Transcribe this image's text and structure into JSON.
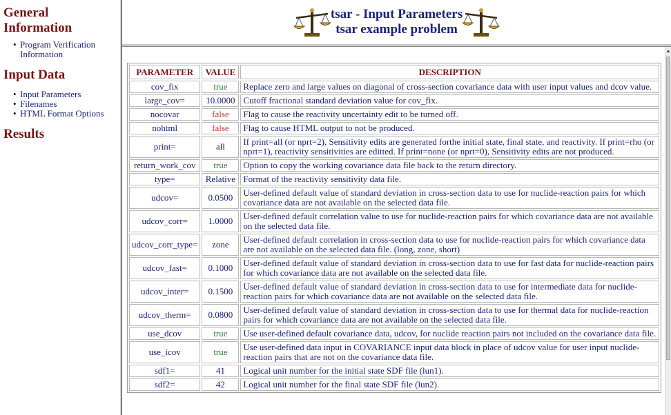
{
  "sidebar": {
    "sections": [
      {
        "title": "General\nInformation"
      },
      {
        "title": "Input Data"
      },
      {
        "title": "Results"
      }
    ],
    "general_title_line1": "General",
    "general_title_line2": "Information",
    "general_links": [
      {
        "label_line1": "Program Verification",
        "label_line2": "Information"
      }
    ],
    "input_title": "Input Data",
    "input_links": [
      {
        "label": "Input Parameters"
      },
      {
        "label": "Filenames"
      },
      {
        "label": "HTML Format Options"
      }
    ],
    "results_title": "Results"
  },
  "header": {
    "title_line1": "tsar - Input Parameters",
    "title_line2": "tsar example problem",
    "icon_left": "scales-icon",
    "icon_right": "scales-icon"
  },
  "table": {
    "headers": {
      "parameter": "PARAMETER",
      "value": "VALUE",
      "description": "DESCRIPTION"
    },
    "rows": [
      {
        "param": "cov_fix",
        "value": "true",
        "value_color": "green",
        "desc": "Replace zero and large values on diagonal of cross-section covariance data with user input values and dcov value."
      },
      {
        "param": "large_cov=",
        "value": "10.0000",
        "value_color": "dark",
        "desc": "Cutoff fractional standard deviation value for cov_fix."
      },
      {
        "param": "nocovar",
        "value": "false",
        "value_color": "red",
        "desc": "Flag to cause the reactivity uncertainty edit to be turned off."
      },
      {
        "param": "nohtml",
        "value": "false",
        "value_color": "red",
        "desc": "Flag to cause HTML output to not be produced."
      },
      {
        "param": "print=",
        "value": "all",
        "value_color": "dark",
        "desc": "If print=all (or nprt=2), Sensitivity edits are generated forthe initial state, final state, and reactivity. If print=rho (or nprt=1), reactivity sensitivities are editted. If print=none (or nprt=0), Sensitivity edits are not produced."
      },
      {
        "param": "return_work_cov",
        "value": "true",
        "value_color": "green",
        "desc": "Option to copy the working covariance data file back to the return directory."
      },
      {
        "param": "type=",
        "value": "Relative",
        "value_color": "dark",
        "desc": "Format of the reactivity sensitivity data file."
      },
      {
        "param": "udcov=",
        "value": "0.0500",
        "value_color": "dark",
        "desc": "User-defined default value of standard deviation in cross-section data to use for nuclide-reaction pairs for which covariance data are not available on the selected data file."
      },
      {
        "param": "udcov_corr=",
        "value": "1.0000",
        "value_color": "dark",
        "desc": "User-defined default correlation value to use for nuclide-reaction pairs for which covariance data are not available on the selected data file."
      },
      {
        "param": "udcov_corr_type=",
        "value": "zone",
        "value_color": "dark",
        "desc": "User-defined default correlation in cross-section data to use for nuclide-reaction pairs for which covariance data are not available on the selected data file. (long, zone, short)"
      },
      {
        "param": "udcov_fast=",
        "value": "0.1000",
        "value_color": "dark",
        "desc": "User-defined default value of standard deviation in cross-section data to use for fast data for nuclide-reaction pairs for which covariance data are not available on the selected data file."
      },
      {
        "param": "udcov_inter=",
        "value": "0.1500",
        "value_color": "dark",
        "desc": "User-defined default value of standard deviation in cross-section data to use for intermediate data for nuclide-reaction pairs for which covariance data are not available on the selected data file."
      },
      {
        "param": "udcov_therm=",
        "value": "0.0800",
        "value_color": "dark",
        "desc": "User-defined default value of standard deviation in cross-section data to use for thermal data for nuclide-reaction pairs for which covariance data are not available on the selected data file."
      },
      {
        "param": "use_dcov",
        "value": "true",
        "value_color": "green",
        "desc": "Use user-defined default covariance data, udcov, for nuclide reaction pairs not included on the covariance data file."
      },
      {
        "param": "use_icov",
        "value": "true",
        "value_color": "green",
        "desc": "Use user-defined data input in COVARIANCE input data block in place of udcov value for user input nuclide-reaction pairs that are not on the covariance data file."
      },
      {
        "param": "sdf1=",
        "value": "41",
        "value_color": "dark",
        "desc": "Logical unit number for the initial state SDF file (lun1)."
      },
      {
        "param": "sdf2=",
        "value": "42",
        "value_color": "dark",
        "desc": "Logical unit number for the final state SDF file (lun2)."
      }
    ]
  },
  "colors": {
    "heading": "#7b1414",
    "text": "#1a237e",
    "true_value": "#2e7d32",
    "false_value": "#d32f2f"
  }
}
